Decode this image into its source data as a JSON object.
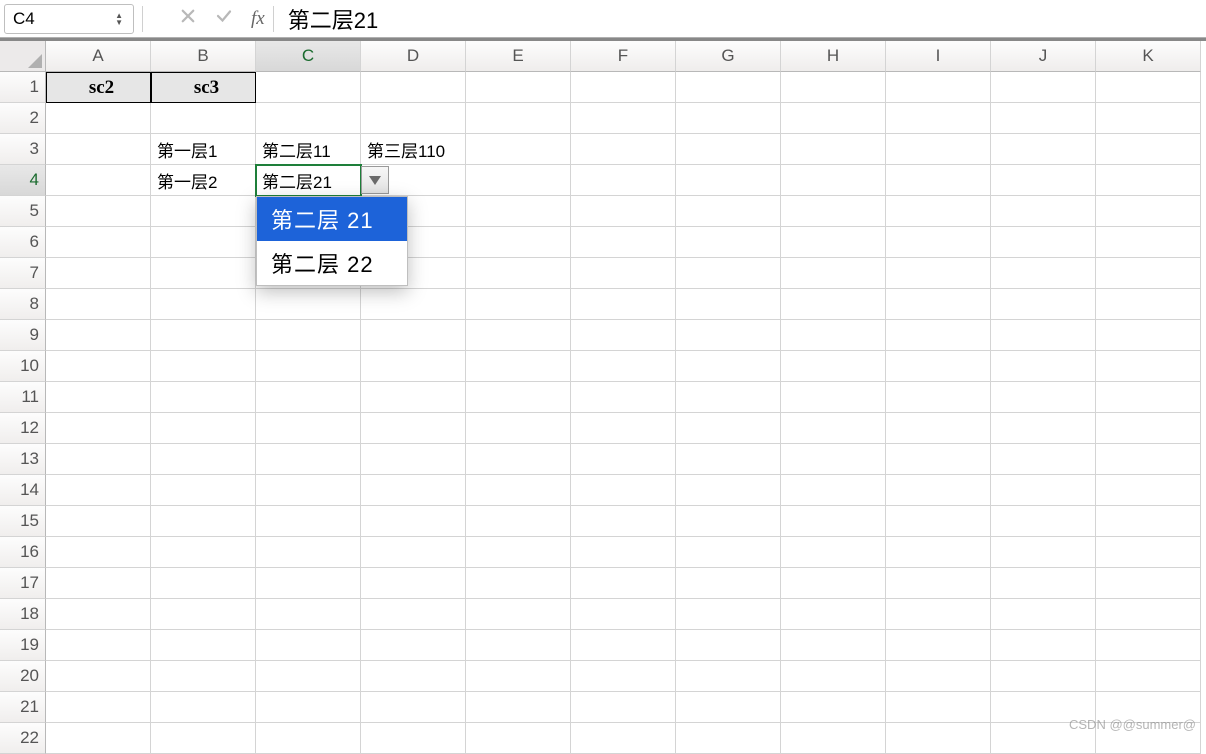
{
  "formula_bar": {
    "cell_ref": "C4",
    "formula_value": "第二层21"
  },
  "columns": [
    "A",
    "B",
    "C",
    "D",
    "E",
    "F",
    "G",
    "H",
    "I",
    "J",
    "K"
  ],
  "active_col_index": 2,
  "row_count": 22,
  "active_row_index": 3,
  "cells": {
    "A1": "sc2",
    "B1": "sc3",
    "B3": "第一层1",
    "C3": "第二层11",
    "D3": "第三层110",
    "B4": "第一层2",
    "C4": "第二层21"
  },
  "gray_cells": [
    "A1",
    "B1"
  ],
  "selected_cell": "C4",
  "dropdown": {
    "anchor_cell": "C4",
    "items": [
      "第二层 21",
      "第二层 22"
    ],
    "highlight_index": 0
  },
  "watermark": "CSDN @@summer@"
}
